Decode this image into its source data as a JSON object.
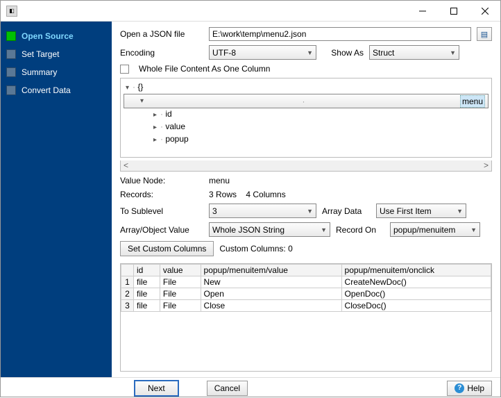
{
  "steps": [
    "Open Source",
    "Set Target",
    "Summary",
    "Convert Data"
  ],
  "activeStep": 0,
  "open": {
    "label": "Open a JSON file",
    "path": "E:\\work\\temp\\menu2.json"
  },
  "encoding": {
    "label": "Encoding",
    "value": "UTF-8"
  },
  "showAs": {
    "label": "Show As",
    "value": "Struct"
  },
  "wholeFile": {
    "label": "Whole File Content As One Column"
  },
  "tree": {
    "root": "{}",
    "sel": "menu",
    "children": [
      "id",
      "value",
      "popup"
    ]
  },
  "valueNode": {
    "label": "Value Node:",
    "value": "menu"
  },
  "records": {
    "label": "Records:",
    "value": "3 Rows    4 Columns"
  },
  "toSub": {
    "label": "To Sublevel",
    "value": "3"
  },
  "arrayData": {
    "label": "Array Data",
    "value": "Use First Item"
  },
  "aov": {
    "label": "Array/Object Value",
    "value": "Whole JSON String"
  },
  "recOn": {
    "label": "Record On",
    "value": "popup/menuitem"
  },
  "setCols": "Set Custom Columns",
  "customCols": "Custom Columns: 0",
  "table": {
    "headers": [
      "id",
      "value",
      "popup/menuitem/value",
      "popup/menuitem/onclick"
    ],
    "rows": [
      [
        "file",
        "File",
        "New",
        "CreateNewDoc()"
      ],
      [
        "file",
        "File",
        "Open",
        "OpenDoc()"
      ],
      [
        "file",
        "File",
        "Close",
        "CloseDoc()"
      ]
    ]
  },
  "buttons": {
    "next": "Next",
    "cancel": "Cancel",
    "help": "Help"
  }
}
